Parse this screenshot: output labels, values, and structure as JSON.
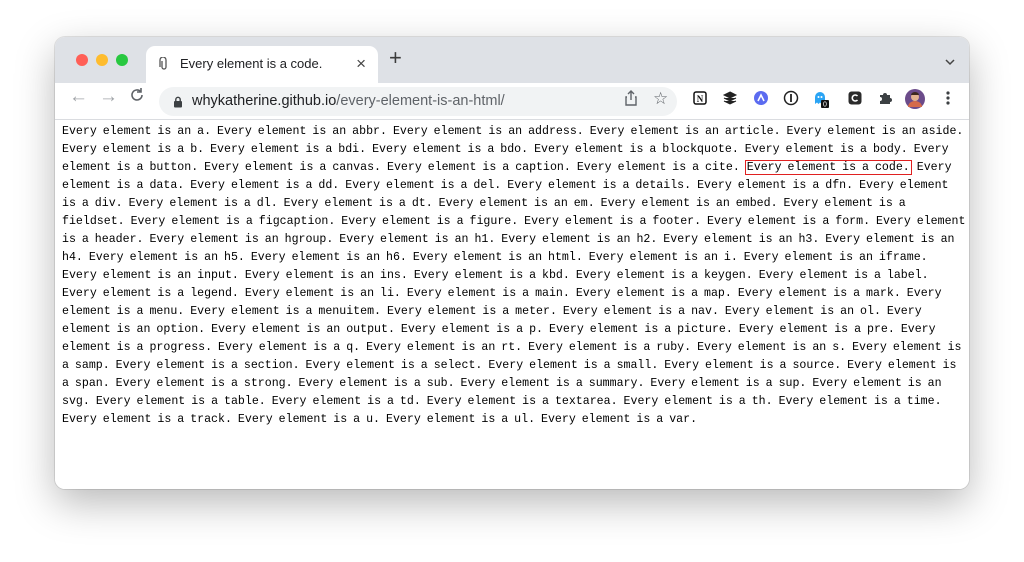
{
  "window": {
    "traffic_lights": {
      "close": "#ff5f57",
      "minimize": "#febc2e",
      "zoom": "#28c840"
    }
  },
  "tab": {
    "title": "Every element is a code.",
    "favicon": "paperclip-icon",
    "close": "×"
  },
  "new_tab": "+",
  "tab_menu": "chevron-down-icon",
  "nav": {
    "back": "←",
    "forward": "→",
    "reload": "C"
  },
  "address": {
    "host": "whykatherine.github.io",
    "path": "/every-element-is-an-html/"
  },
  "extensions": [
    "notion-icon",
    "buffer-icon",
    "arc-icon",
    "onepassword-icon",
    "ghost-icon",
    "chromium-c-icon",
    "puzzle-icon",
    "profile-avatar",
    "more-icon"
  ],
  "extension_badge": "0",
  "highlight_index": 9,
  "elements": [
    "Every element is an a.",
    "Every element is an abbr.",
    "Every element is an address.",
    "Every element is an article.",
    "Every element is an aside.",
    "Every element is a b.",
    "Every element is a bdi.",
    "Every element is a bdo.",
    "Every element is a blockquote.",
    "Every element is a body.",
    "Every element is a button.",
    "Every element is a canvas.",
    "Every element is a caption.",
    "Every element is a cite.",
    "Every element is a code.",
    "Every element is a data.",
    "Every element is a dd.",
    "Every element is a del.",
    "Every element is a details.",
    "Every element is a dfn.",
    "Every element is a div.",
    "Every element is a dl.",
    "Every element is a dt.",
    "Every element is an em.",
    "Every element is an embed.",
    "Every element is a fieldset.",
    "Every element is a figcaption.",
    "Every element is a figure.",
    "Every element is a footer.",
    "Every element is a form.",
    "Every element is a header.",
    "Every element is an hgroup.",
    "Every element is an h1.",
    "Every element is an h2.",
    "Every element is an h3.",
    "Every element is an h4.",
    "Every element is an h5.",
    "Every element is an h6.",
    "Every element is an html.",
    "Every element is an i.",
    "Every element is an iframe.",
    "Every element is an input.",
    "Every element is an ins.",
    "Every element is a kbd.",
    "Every element is a keygen.",
    "Every element is a label.",
    "Every element is a legend.",
    "Every element is an li.",
    "Every element is a main.",
    "Every element is a map.",
    "Every element is a mark.",
    "Every element is a menu.",
    "Every element is a menuitem.",
    "Every element is a meter.",
    "Every element is a nav.",
    "Every element is an ol.",
    "Every element is an option.",
    "Every element is an output.",
    "Every element is a p.",
    "Every element is a picture.",
    "Every element is a pre.",
    "Every element is a progress.",
    "Every element is a q.",
    "Every element is an rt.",
    "Every element is a ruby.",
    "Every element is an s.",
    "Every element is a samp.",
    "Every element is a section.",
    "Every element is a select.",
    "Every element is a small.",
    "Every element is a source.",
    "Every element is a span.",
    "Every element is a strong.",
    "Every element is a sub.",
    "Every element is a summary.",
    "Every element is a sup.",
    "Every element is an svg.",
    "Every element is a table.",
    "Every element is a td.",
    "Every element is a textarea.",
    "Every element is a th.",
    "Every element is a time.",
    "Every element is a track.",
    "Every element is a u.",
    "Every element is a ul.",
    "Every element is a var."
  ]
}
